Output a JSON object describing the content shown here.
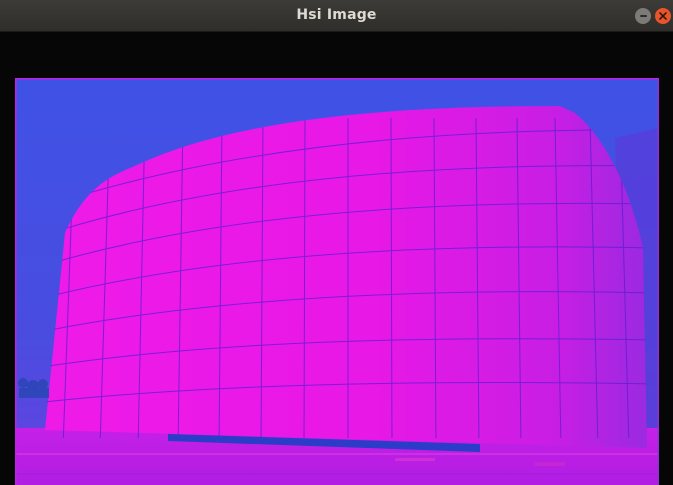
{
  "window": {
    "title": "Hsi Image"
  },
  "titlebar_buttons": {
    "minimize": "minimize-icon",
    "close": "close-icon"
  },
  "image": {
    "description_icon": "hsi-converted-photo",
    "colors": {
      "sky": "#4a4ce0",
      "building": "#e818e6",
      "ground": "#b01ee0",
      "grid_lines": "#5a1ed0"
    }
  }
}
